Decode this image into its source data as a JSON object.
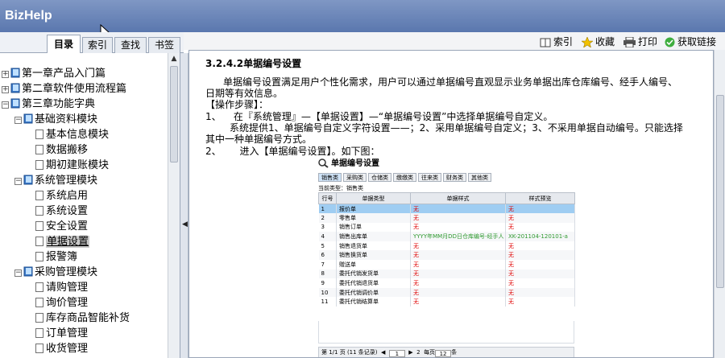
{
  "app": {
    "title": "BizHelp"
  },
  "tabs": [
    {
      "label": "目录"
    },
    {
      "label": "索引"
    },
    {
      "label": "查找"
    },
    {
      "label": "书签"
    }
  ],
  "toolbar": {
    "index_label": "索引",
    "favorites_label": "收藏",
    "print_label": "打印",
    "link_label": "获取链接"
  },
  "tree": [
    {
      "label": "第一章产品入门篇"
    },
    {
      "label": "第二章软件使用流程篇"
    },
    {
      "label": "第三章功能字典"
    },
    {
      "label": "基础资料模块"
    },
    {
      "label": "基本信息模块"
    },
    {
      "label": "数据搬移"
    },
    {
      "label": "期初建账模块"
    },
    {
      "label": "系统管理模块"
    },
    {
      "label": "系统启用"
    },
    {
      "label": "系统设置"
    },
    {
      "label": "安全设置"
    },
    {
      "label": "单据设置"
    },
    {
      "label": "报警簿"
    },
    {
      "label": "采购管理模块"
    },
    {
      "label": "请购管理"
    },
    {
      "label": "询价管理"
    },
    {
      "label": "库存商品智能补货"
    },
    {
      "label": "订单管理"
    },
    {
      "label": "收货管理"
    }
  ],
  "content": {
    "section_title": "3.2.4.2单据编号设置",
    "intro_1": "单据编号设置满足用户个性化需求，用户可以通过单据编号直观显示业务单据出库仓库编号、经手人编号、",
    "intro_2": "日期等有效信息。",
    "steps_heading": "【操作步骤】：",
    "step1_num": "1、",
    "step1_text": "在『系统管理』—【单据设置】—“单据编号设置”中选择单据编号自定义。",
    "step1_desc_1": "系统提供1、单据编号自定义字符设置——；2、采用单据编号自定义；3、不采用单据自动编号。只能选择",
    "step1_desc_2": "其中一种单据编号方式。",
    "step2_num": "2、",
    "step2_text": "进入【单据编号设置】。如下图："
  },
  "figure": {
    "title": "单据编号设置",
    "buttons": [
      "销售类",
      "采购类",
      "仓储类",
      "缴缴类",
      "往来类",
      "财务类",
      "其他类"
    ],
    "current_type": "当前类型：销售类",
    "columns": [
      "行号",
      "单据类型",
      "单据样式",
      "样式预览"
    ],
    "rows": [
      {
        "no": "1",
        "type": "报价单",
        "style": "无",
        "preview": "无"
      },
      {
        "no": "2",
        "type": "零售单",
        "style": "无",
        "preview": "无"
      },
      {
        "no": "3",
        "type": "销售订单",
        "style": "无",
        "preview": "无"
      },
      {
        "no": "4",
        "type": "销售出库单",
        "style": "YYYY年MM月DD日仓库编号-经手人",
        "preview": "XK-201104-120101-a"
      },
      {
        "no": "5",
        "type": "销售退货单",
        "style": "无",
        "preview": "无"
      },
      {
        "no": "6",
        "type": "销售换货单",
        "style": "无",
        "preview": "无"
      },
      {
        "no": "7",
        "type": "赠送单",
        "style": "无",
        "preview": "无"
      },
      {
        "no": "8",
        "type": "委托代销发货单",
        "style": "无",
        "preview": "无"
      },
      {
        "no": "9",
        "type": "委托代销退货单",
        "style": "无",
        "preview": "无"
      },
      {
        "no": "10",
        "type": "委托代销调价单",
        "style": "无",
        "preview": "无"
      },
      {
        "no": "11",
        "type": "委托代销结算单",
        "style": "无",
        "preview": "无"
      }
    ],
    "pager": {
      "info": "第 1/1 页 (11 条记录)",
      "current_page": "1",
      "next_page": "2",
      "per_page_label": "每页",
      "per_page_value": "12",
      "per_page_unit": "条"
    }
  },
  "colors": {
    "titlebar": "#6c86b9",
    "selected_row": "#9fcdf2",
    "red_text": "#e00000",
    "green_text": "#2f9a2f"
  }
}
